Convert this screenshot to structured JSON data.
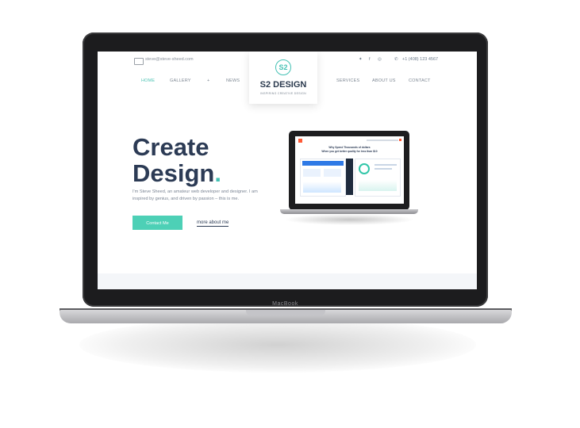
{
  "device": {
    "brand_label": "MacBook"
  },
  "topbar": {
    "email": "steve@steve-sheed.com",
    "social_icons": [
      "twitter-icon",
      "facebook-icon",
      "instagram-icon"
    ],
    "social_glyphs": [
      "✦",
      "f",
      "◎"
    ],
    "phone": "+1 (408) 123 4567"
  },
  "nav": {
    "left": [
      "HOME",
      "GALLERY",
      "+",
      "NEWS"
    ],
    "right": [
      "SERVICES",
      "ABOUT US",
      "CONTACT"
    ],
    "active": "HOME"
  },
  "logo": {
    "mark": "S2",
    "title": "S2 DESIGN",
    "tagline": "INSPIRING CREATIVE DESIGN"
  },
  "hero": {
    "line1": "Create",
    "line2": "Design",
    "dot": ".",
    "intro": "I'm Steve Sheed, an amateur web developer and designer. I am inspired by genius, and driven by passion – this is me.",
    "cta_primary": "Contact Me",
    "cta_secondary": "more about me"
  },
  "mockup": {
    "headline1": "Why Spend Thousands of dollars",
    "headline2": "When you get better quality for less than $10"
  },
  "colors": {
    "accent": "#4dd0b6",
    "heading": "#2c3b55",
    "frame": "#1c1c1e"
  }
}
